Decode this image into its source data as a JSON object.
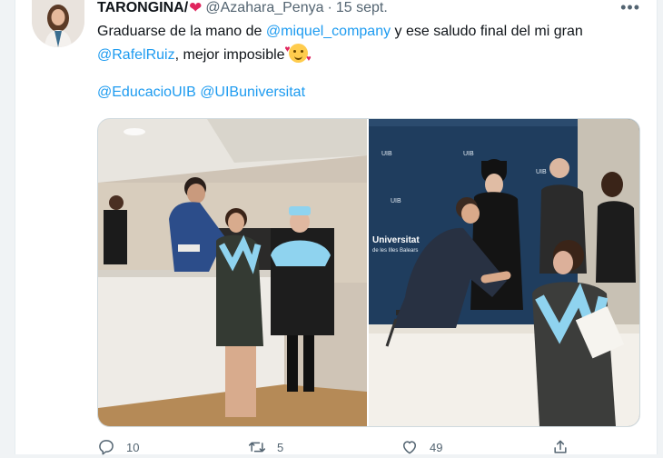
{
  "tweet": {
    "author_name": "TARONGINA/",
    "author_handle": "@Azahara_Penya",
    "separator": "·",
    "date": "15 sept.",
    "more_glyph": "•••",
    "text_line1_a": "Graduarse de la mano de ",
    "mention_1": "@miquel_company",
    "text_line1_b": " y ese saludo final del mi gran",
    "mention_2": "@RafelRuiz",
    "text_line2_b": ", mejor imposible",
    "tag_1": "@EducacioUIB",
    "tag_2": "@UIBuniversitat"
  },
  "photo_text": {
    "sign_1": "UIB",
    "sign_2": "Universitat",
    "sign_3": "de les Illes Balears"
  },
  "actions": {
    "replies": "10",
    "retweets": "5",
    "likes": "49"
  },
  "colors": {
    "accent": "#1d9bf0",
    "heart": "#e0245e",
    "muted": "#536471",
    "backdrop": "#1f3d5e",
    "sash": "#8fd3ef"
  },
  "icons": {
    "author_emoji": "red-heart-icon",
    "text_emoji": "smiling-face-with-hearts-icon",
    "more": "more-icon",
    "reply": "reply-icon",
    "retweet": "retweet-icon",
    "like": "like-icon",
    "share": "share-icon"
  }
}
